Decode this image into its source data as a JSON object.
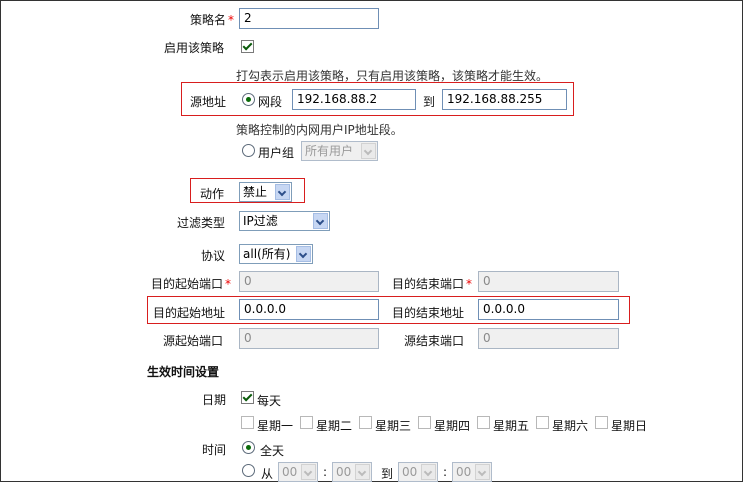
{
  "policy_name": {
    "label": "策略名",
    "required_mark": "*",
    "value": "2"
  },
  "enable": {
    "label": "启用该策略",
    "checked": true,
    "hint": "打勾表示启用该策略，只有启用该策略，该策略才能生效。"
  },
  "source": {
    "label": "源地址",
    "segment_label": "网段",
    "start_ip": "192.168.88.2",
    "to_label": "到",
    "end_ip": "192.168.88.255",
    "hint": "策略控制的内网用户IP地址段。",
    "group_label": "用户组",
    "group_value": "所有用户"
  },
  "action": {
    "label": "动作",
    "value": "禁止"
  },
  "filter_type": {
    "label": "过滤类型",
    "value": "IP过滤"
  },
  "protocol": {
    "label": "协议",
    "value": "all(所有)"
  },
  "dest_port_start": {
    "label": "目的起始端口",
    "required_mark": "*",
    "value": "0"
  },
  "dest_port_end": {
    "label": "目的结束端口",
    "required_mark": "*",
    "value": "0"
  },
  "dest_addr_start": {
    "label": "目的起始地址",
    "value": "0.0.0.0"
  },
  "dest_addr_end": {
    "label": "目的结束地址",
    "value": "0.0.0.0"
  },
  "src_port_start": {
    "label": "源起始端口",
    "value": "0"
  },
  "src_port_end": {
    "label": "源结束端口",
    "value": "0"
  },
  "schedule": {
    "heading": "生效时间设置",
    "date_label": "日期",
    "everyday_label": "每天",
    "weekdays": [
      "星期一",
      "星期二",
      "星期三",
      "星期四",
      "星期五",
      "星期六",
      "星期日"
    ],
    "time_label": "时间",
    "allday_label": "全天",
    "from_label": "从",
    "to_label": "到",
    "colon": ":",
    "from_hour": "00",
    "from_min": "00",
    "to_hour": "00",
    "to_min": "00"
  },
  "colors": {
    "highlight_border": "#d81e1e",
    "input_border": "#6f8fb5",
    "check_mark": "#0a5a0a"
  }
}
